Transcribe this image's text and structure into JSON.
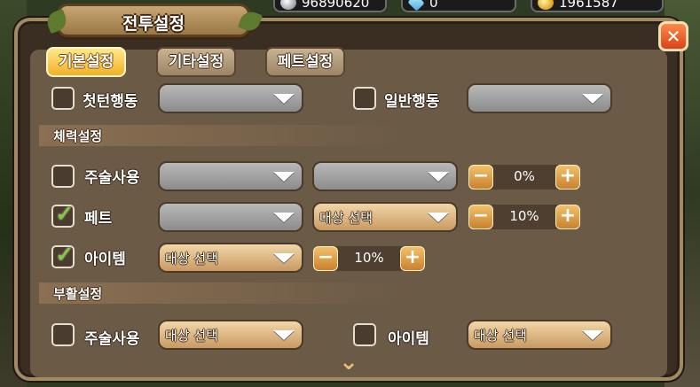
{
  "topbar": {
    "silver": "96890620",
    "gem": "0",
    "gold": "1961587"
  },
  "window": {
    "title": "전투설정",
    "close_label": "✕"
  },
  "tabs": [
    {
      "label": "기본설정",
      "active": true
    },
    {
      "label": "기타설정",
      "active": false
    },
    {
      "label": "페트설정",
      "active": false
    }
  ],
  "top_row": {
    "first_turn": {
      "label": "첫턴행동",
      "checked": false,
      "value": ""
    },
    "normal": {
      "label": "일반행동",
      "checked": false,
      "value": ""
    }
  },
  "hp_section": {
    "title": "체력설정",
    "rows": [
      {
        "label": "주술사용",
        "checked": false,
        "select1": "",
        "select2": "",
        "percent": "0%"
      },
      {
        "label": "페트",
        "checked": true,
        "select1": "",
        "select2": "대상 선택",
        "percent": "10%"
      },
      {
        "label": "아이템",
        "checked": true,
        "select1": "대상 선택",
        "percent": "10%"
      }
    ]
  },
  "revive_section": {
    "title": "부활설정",
    "spell": {
      "label": "주술사용",
      "checked": false,
      "value": "대상 선택"
    },
    "item": {
      "label": "아이템",
      "checked": false,
      "value": "대상 선택"
    }
  },
  "icons": {
    "minus": "−",
    "plus": "+",
    "check": "✓",
    "scroll": "⌄"
  }
}
